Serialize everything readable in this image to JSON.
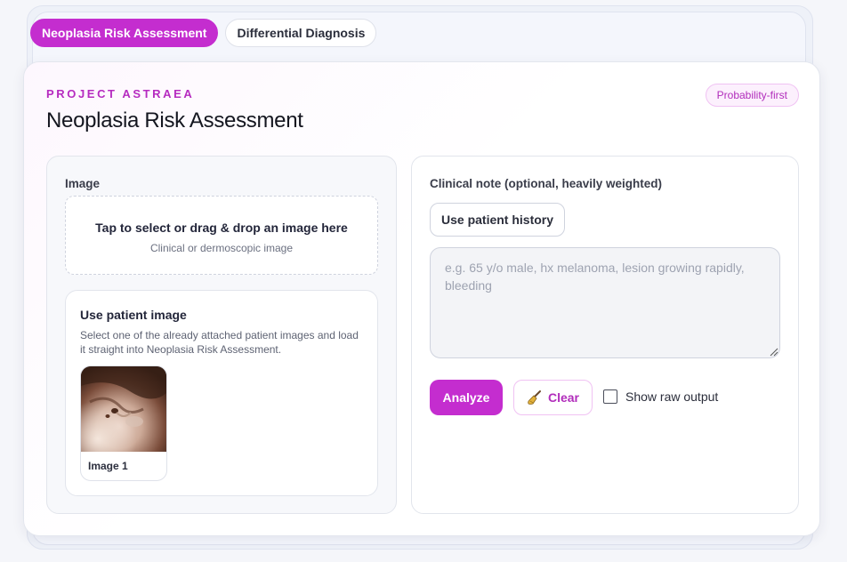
{
  "tabs": [
    {
      "label": "Neoplasia Risk Assessment",
      "active": true
    },
    {
      "label": "Differential Diagnosis",
      "active": false
    }
  ],
  "header": {
    "eyebrow": "PROJECT ASTRAEA",
    "title": "Neoplasia Risk Assessment",
    "badge": "Probability-first"
  },
  "image_panel": {
    "label": "Image",
    "dropzone_main": "Tap to select or drag & drop an image here",
    "dropzone_sub": "Clinical or dermoscopic image",
    "patient_image": {
      "title": "Use patient image",
      "description": "Select one of the already attached patient images and load it straight into Neoplasia Risk Assessment.",
      "thumbnails": [
        {
          "label": "Image 1"
        }
      ]
    }
  },
  "note_panel": {
    "label": "Clinical note (optional, heavily weighted)",
    "history_button": "Use patient history",
    "placeholder": "e.g. 65 y/o male, hx melanoma, lesion growing rapidly, bleeding",
    "analyze_button": "Analyze",
    "clear_button": "Clear",
    "clear_icon": "broom-icon",
    "raw_output_label": "Show raw output",
    "raw_output_checked": false
  },
  "colors": {
    "accent": "#c42dcf",
    "accent_text": "#b12dbb",
    "badge_bg": "#fcf0fd"
  }
}
